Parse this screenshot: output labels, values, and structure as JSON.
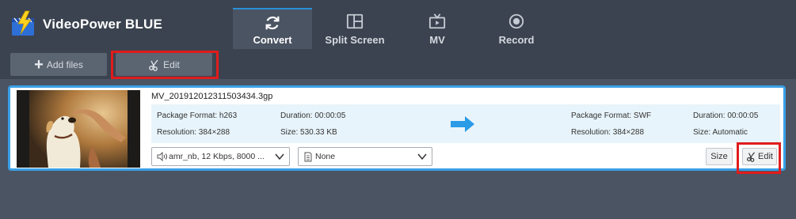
{
  "app": {
    "title": "VideoPower BLUE"
  },
  "tabs": [
    {
      "label": "Convert",
      "icon": "refresh-icon",
      "active": true
    },
    {
      "label": "Split Screen",
      "icon": "split-screen-icon",
      "active": false
    },
    {
      "label": "MV",
      "icon": "tv-icon",
      "active": false
    },
    {
      "label": "Record",
      "icon": "record-icon",
      "active": false
    }
  ],
  "toolbar": {
    "add_files_label": "Add files",
    "edit_label": "Edit"
  },
  "item": {
    "filename": "MV_201912012311503434.3gp",
    "source": {
      "package_format": "Package Format: h263",
      "resolution": "Resolution: 384×288",
      "duration": "Duration: 00:00:05",
      "size": "Size: 530.33 KB"
    },
    "output": {
      "package_format": "Package Format: SWF",
      "resolution": "Resolution: 384×288",
      "duration": "Duration: 00:00:05",
      "size": "Size: Automatic"
    },
    "audio_track": "amr_nb, 12 Kbps, 8000 ...",
    "subtitle": "None",
    "size_button": "Size",
    "edit_button": "Edit"
  },
  "colors": {
    "accent": "#2a8fd8",
    "highlight": "#e01c1c",
    "arrow": "#2a9be6"
  }
}
